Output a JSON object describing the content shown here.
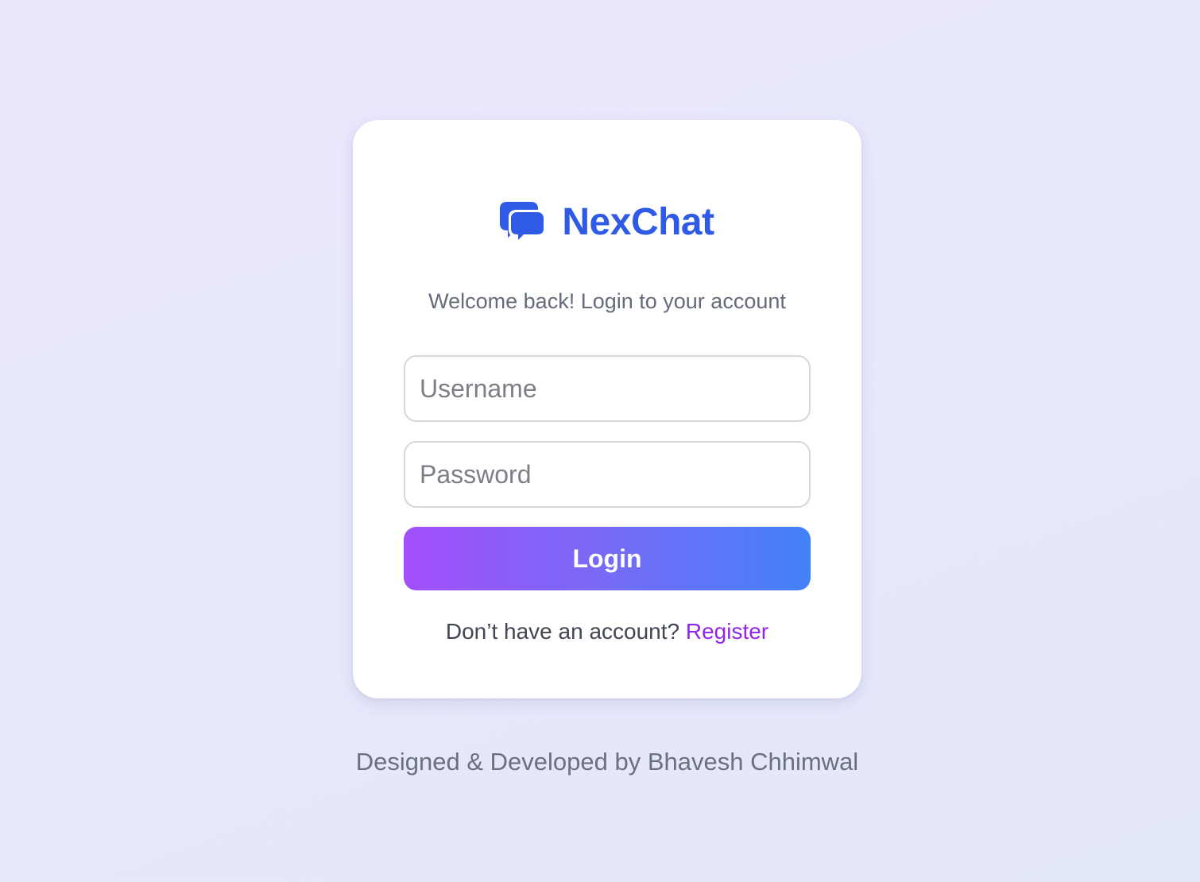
{
  "brand": {
    "name": "NexChat",
    "icon": "chat-bubbles-icon",
    "color": "#2f5ae6"
  },
  "login": {
    "subtitle": "Welcome back! Login to your account",
    "username_placeholder": "Username",
    "username_value": "",
    "password_placeholder": "Password",
    "password_value": "",
    "button_label": "Login",
    "button_gradient": [
      "#a24ffb",
      "#4282f8"
    ],
    "register_prompt": "Don’t have an account?",
    "register_link": "Register",
    "register_link_color": "#9125ea"
  },
  "footer": {
    "credit": "Designed & Developed by Bhavesh Chhimwal"
  }
}
